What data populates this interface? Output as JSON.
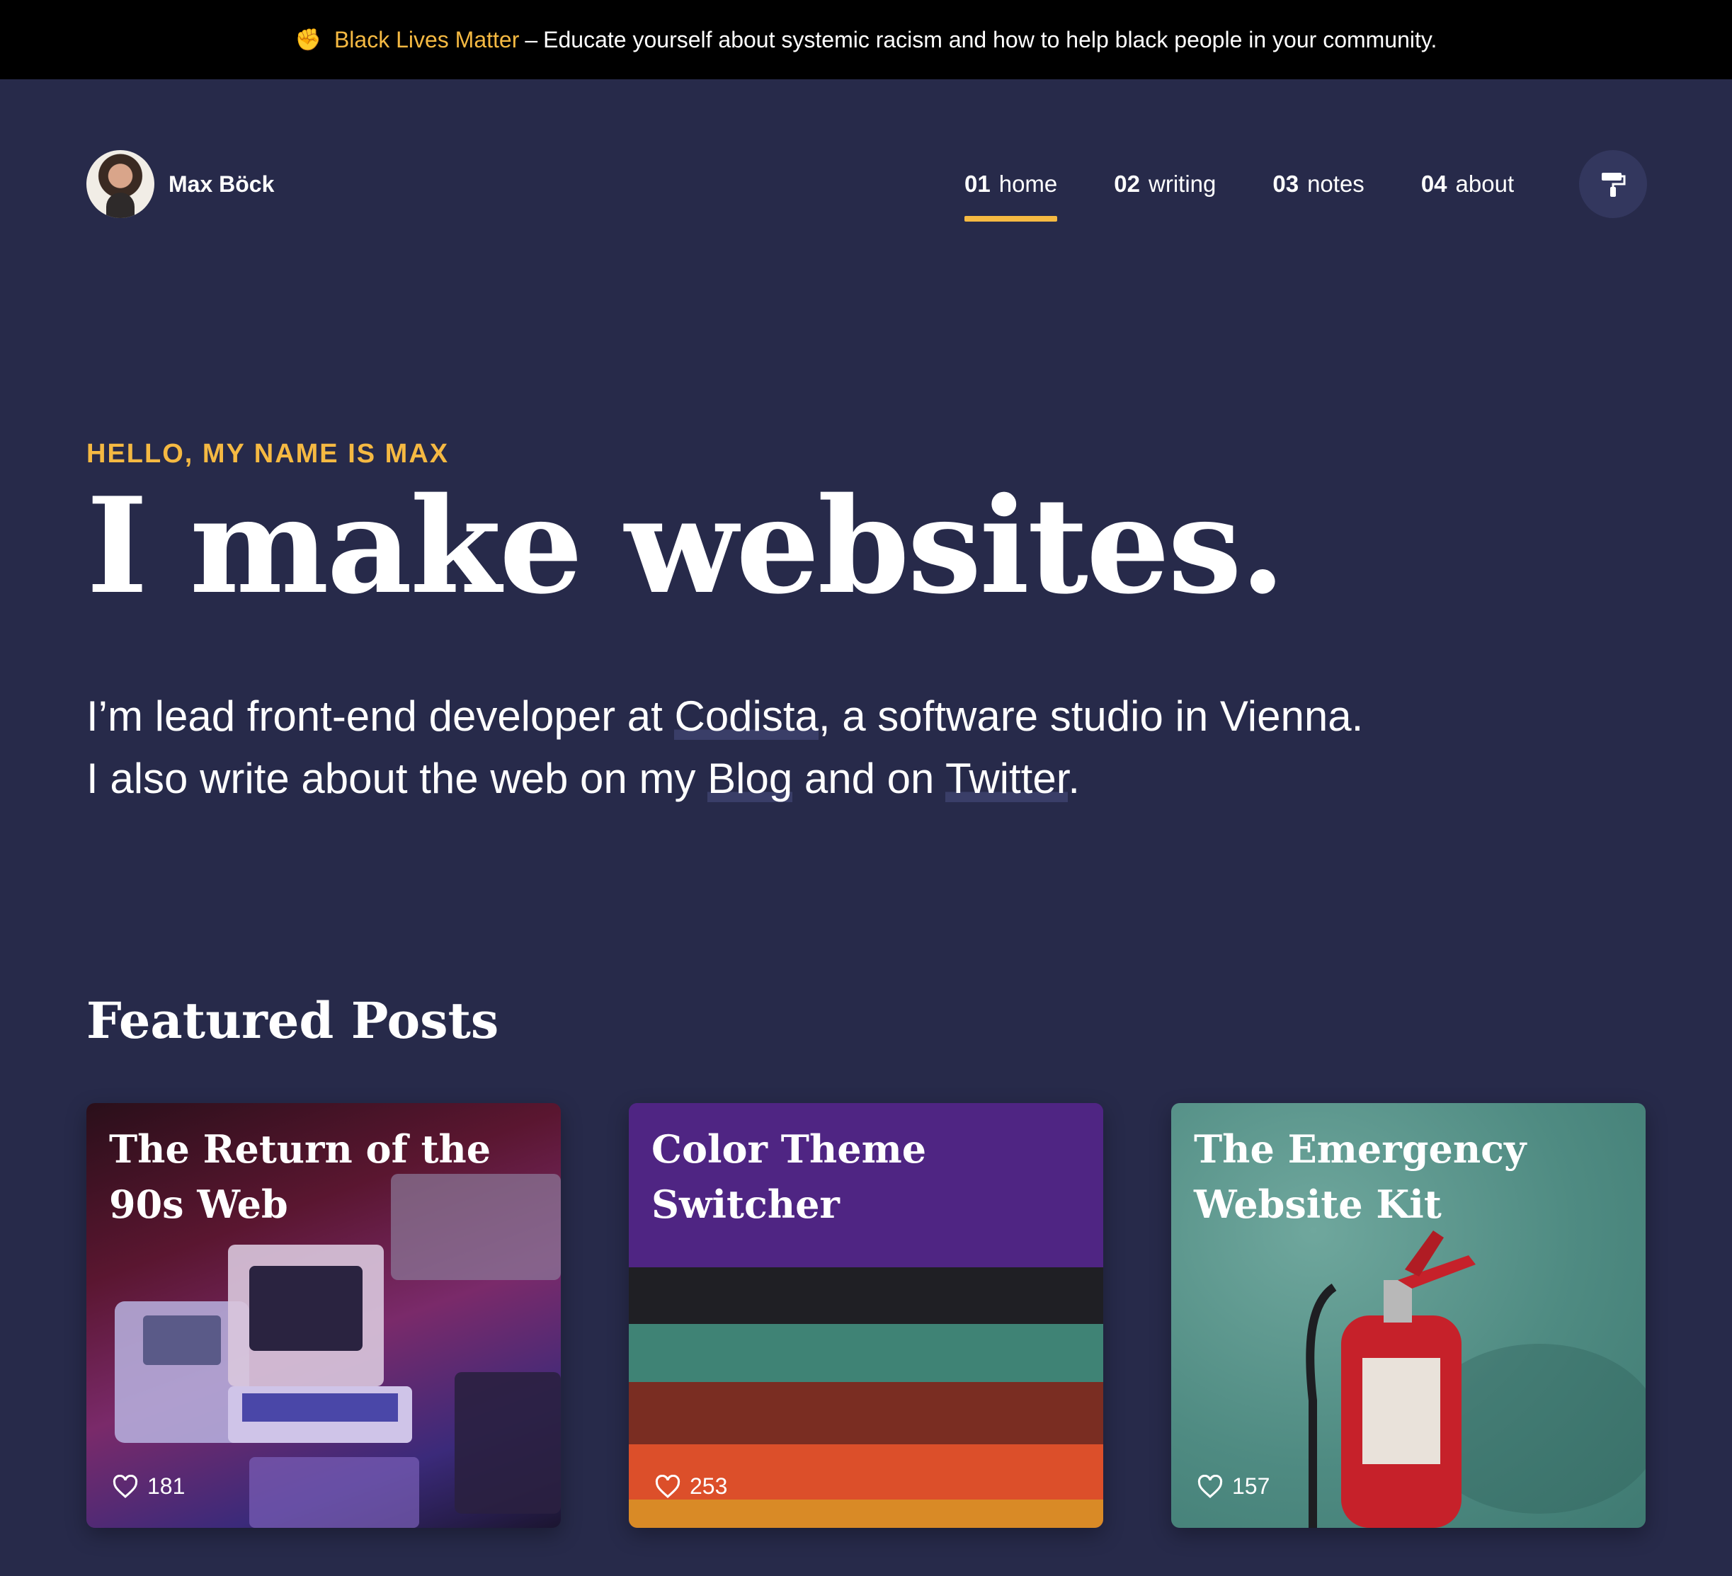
{
  "banner": {
    "icon": "raised-fist-icon",
    "link_text": "Black Lives Matter",
    "separator": "–",
    "message": "Educate yourself about systemic racism and how to help black people in your community."
  },
  "header": {
    "name": "Max Böck",
    "nav": [
      {
        "num": "01",
        "label": "home",
        "active": true
      },
      {
        "num": "02",
        "label": "writing",
        "active": false
      },
      {
        "num": "03",
        "label": "notes",
        "active": false
      },
      {
        "num": "04",
        "label": "about",
        "active": false
      }
    ],
    "theme_button_icon": "paint-roller-icon"
  },
  "hero": {
    "eyebrow": "HELLO, MY NAME IS MAX",
    "headline": "I make websites.",
    "line1_pre": "I’m lead front-end developer at ",
    "line1_link": "Codista",
    "line1_post": ", a software studio in Vienna.",
    "line2_pre": "I also write about the web on my ",
    "line2_link1": "Blog",
    "line2_mid": " and on ",
    "line2_link2": "Twitter",
    "line2_post": "."
  },
  "featured": {
    "title": "Featured Posts",
    "posts": [
      {
        "title": "The Return of the 90s Web",
        "likes": "181",
        "image": "retro-computers"
      },
      {
        "title": "Color Theme Switcher",
        "likes": "253",
        "image": "colored-paper-stripes"
      },
      {
        "title": "The Emergency Website Kit",
        "likes": "157",
        "image": "fire-extinguisher"
      }
    ]
  },
  "colors": {
    "background": "#272a4a",
    "banner": "#000000",
    "accent": "#f5b942",
    "text": "#ffffff"
  }
}
